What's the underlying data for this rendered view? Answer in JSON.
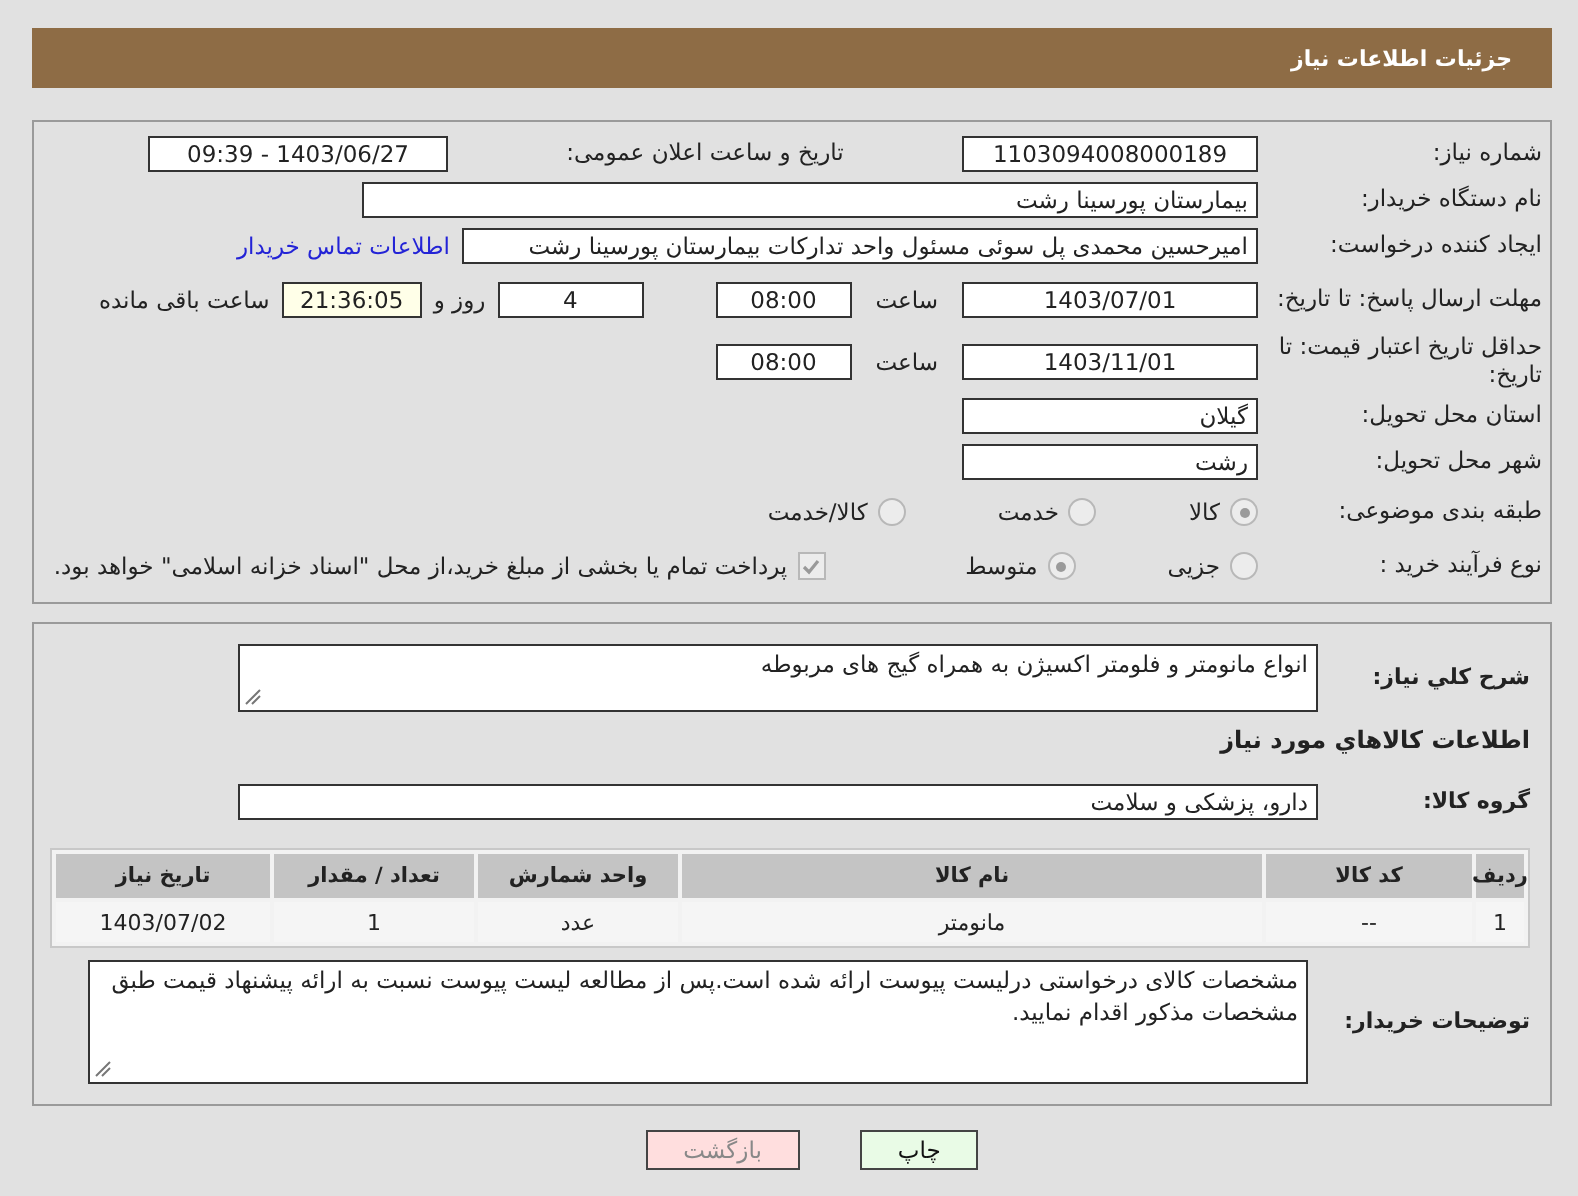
{
  "header": {
    "title": "جزئیات اطلاعات نیاز"
  },
  "need_number": {
    "label": "شماره نیاز:",
    "value": "1103094008000189"
  },
  "announce": {
    "label": "تاریخ و ساعت اعلان عمومی:",
    "value": "1403/06/27 - 09:39"
  },
  "buyer_org": {
    "label": "نام دستگاه خریدار:",
    "value": "بیمارستان پورسینا رشت"
  },
  "requester": {
    "label": "ایجاد کننده درخواست:",
    "value": "امیرحسین محمدی پل سوئی مسئول واحد تدارکات بیمارستان پورسینا رشت",
    "link": "اطلاعات تماس خریدار"
  },
  "response_deadline": {
    "label": "مهلت ارسال پاسخ: تا تاریخ:",
    "date": "1403/07/01",
    "time_label": "ساعت",
    "time": "08:00",
    "days": "4",
    "days_label": "روز و",
    "remaining": "21:36:05",
    "remaining_label": "ساعت باقی مانده"
  },
  "price_validity": {
    "label": "حداقل تاریخ اعتبار قیمت: تا تاریخ:",
    "date": "1403/11/01",
    "time_label": "ساعت",
    "time": "08:00"
  },
  "province": {
    "label": "استان محل تحویل:",
    "value": "گیلان"
  },
  "city": {
    "label": "شهر محل تحویل:",
    "value": "رشت"
  },
  "category": {
    "label": "طبقه بندی موضوعی:",
    "options": [
      {
        "label": "کالا",
        "selected": true
      },
      {
        "label": "خدمت",
        "selected": false
      },
      {
        "label": "کالا/خدمت",
        "selected": false
      }
    ]
  },
  "process": {
    "label": "نوع فرآیند خرید :",
    "options": [
      {
        "label": "جزیی",
        "selected": false
      },
      {
        "label": "متوسط",
        "selected": true
      }
    ],
    "payment": {
      "label": "پرداخت تمام یا بخشی از مبلغ خرید،از محل \"اسناد خزانه اسلامی\" خواهد بود.",
      "checked": true
    }
  },
  "description": {
    "label": "شرح کلي نیاز:",
    "value": "انواع مانومتر و فلومتر اکسیژن به همراه گیج های مربوطه"
  },
  "goods_title": "اطلاعات کالاهاي مورد نیاز",
  "goods_group": {
    "label": "گروه کالا:",
    "value": "دارو، پزشکی و سلامت"
  },
  "table": {
    "columns": [
      "ردیف",
      "کد کالا",
      "نام کالا",
      "واحد شمارش",
      "تعداد / مقدار",
      "تاریخ نیاز"
    ],
    "rows": [
      [
        "1",
        "--",
        "مانومتر",
        "عدد",
        "1",
        "1403/07/02"
      ]
    ]
  },
  "buyer_notes": {
    "label": "توضیحات خریدار:",
    "value": "مشخصات کالای درخواستی درلیست پیوست ارائه شده است.پس از مطالعه لیست پیوست نسبت به ارائه پیشنهاد قیمت طبق مشخصات مذکور اقدام نمایید."
  },
  "buttons": [
    {
      "label": "چاپ",
      "kind": "print"
    },
    {
      "label": "بازگشت",
      "kind": "back"
    }
  ]
}
